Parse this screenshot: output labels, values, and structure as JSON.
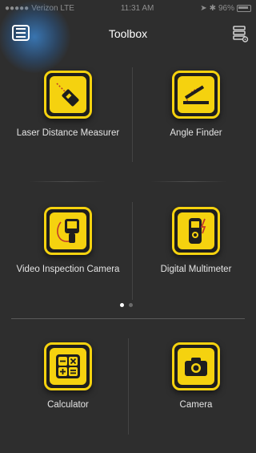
{
  "status_bar": {
    "carrier": "Verizon LTE",
    "time": "11:31 AM",
    "battery": "96%"
  },
  "header": {
    "title": "Toolbox"
  },
  "tools": [
    {
      "label": "Laser Distance Measurer",
      "icon": "laser-distance-icon"
    },
    {
      "label": "Angle Finder",
      "icon": "angle-finder-icon"
    },
    {
      "label": "Video Inspection Camera",
      "icon": "inspection-camera-icon"
    },
    {
      "label": "Digital Multimeter",
      "icon": "multimeter-icon"
    }
  ],
  "pager": {
    "pages": 2,
    "current": 1
  },
  "bottom_tools": [
    {
      "label": "Calculator",
      "icon": "calculator-icon"
    },
    {
      "label": "Camera",
      "icon": "camera-icon"
    }
  ],
  "colors": {
    "accent": "#f5d20f",
    "background": "#2e2e2e",
    "menu_glow": "#3c8cdc"
  }
}
